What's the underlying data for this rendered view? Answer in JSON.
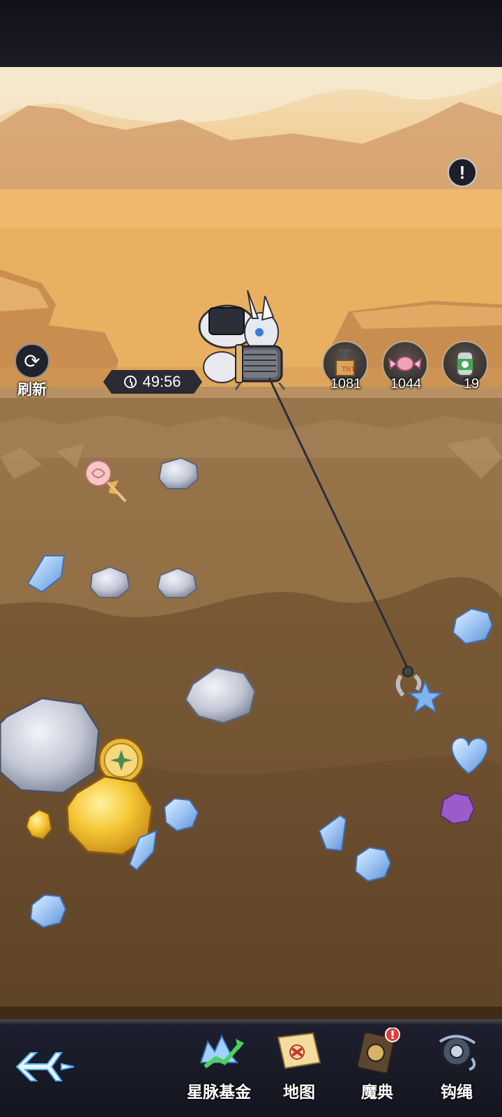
{
  "hud": {
    "refresh_label": "刷新",
    "timer": "49:56",
    "alert_glyph": "!"
  },
  "items": [
    {
      "name": "dynamite",
      "count": "1081"
    },
    {
      "name": "candy",
      "count": "1044"
    },
    {
      "name": "potion-can",
      "count": "19"
    }
  ],
  "nav": {
    "star_fund": "星脉基金",
    "map": "地图",
    "grimoire": "魔典",
    "hook_rope": "钩绳"
  },
  "colors": {
    "sky": "#f2d3a1",
    "desert": "#e6ad63",
    "soil_top": "#8c6a40",
    "soil_deep": "#6b4e2f",
    "gem_blue": "#9ec4f2",
    "gold": "#f2c230",
    "purple_gem": "#9b5bc9"
  }
}
